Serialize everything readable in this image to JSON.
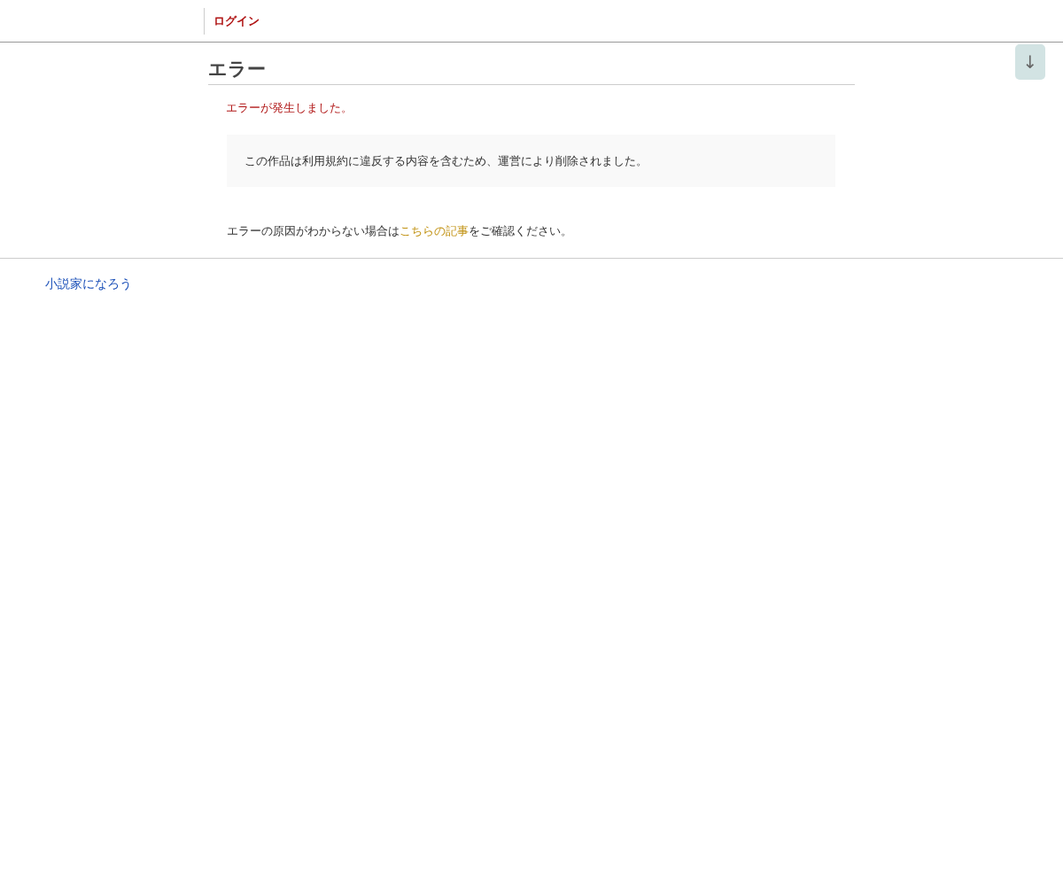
{
  "header": {
    "login_link": "ログイン"
  },
  "scroll_button": {
    "label": "↓"
  },
  "main": {
    "title": "エラー",
    "error_message": "エラーが発生しました。",
    "notice": "この作品は利用規約に違反する内容を含むため、運営により削除されました。",
    "help": {
      "before": "エラーの原因がわからない場合は",
      "link": "こちらの記事",
      "after": "をご確認ください。"
    }
  },
  "footer": {
    "site_link": "小説家になろう"
  }
}
